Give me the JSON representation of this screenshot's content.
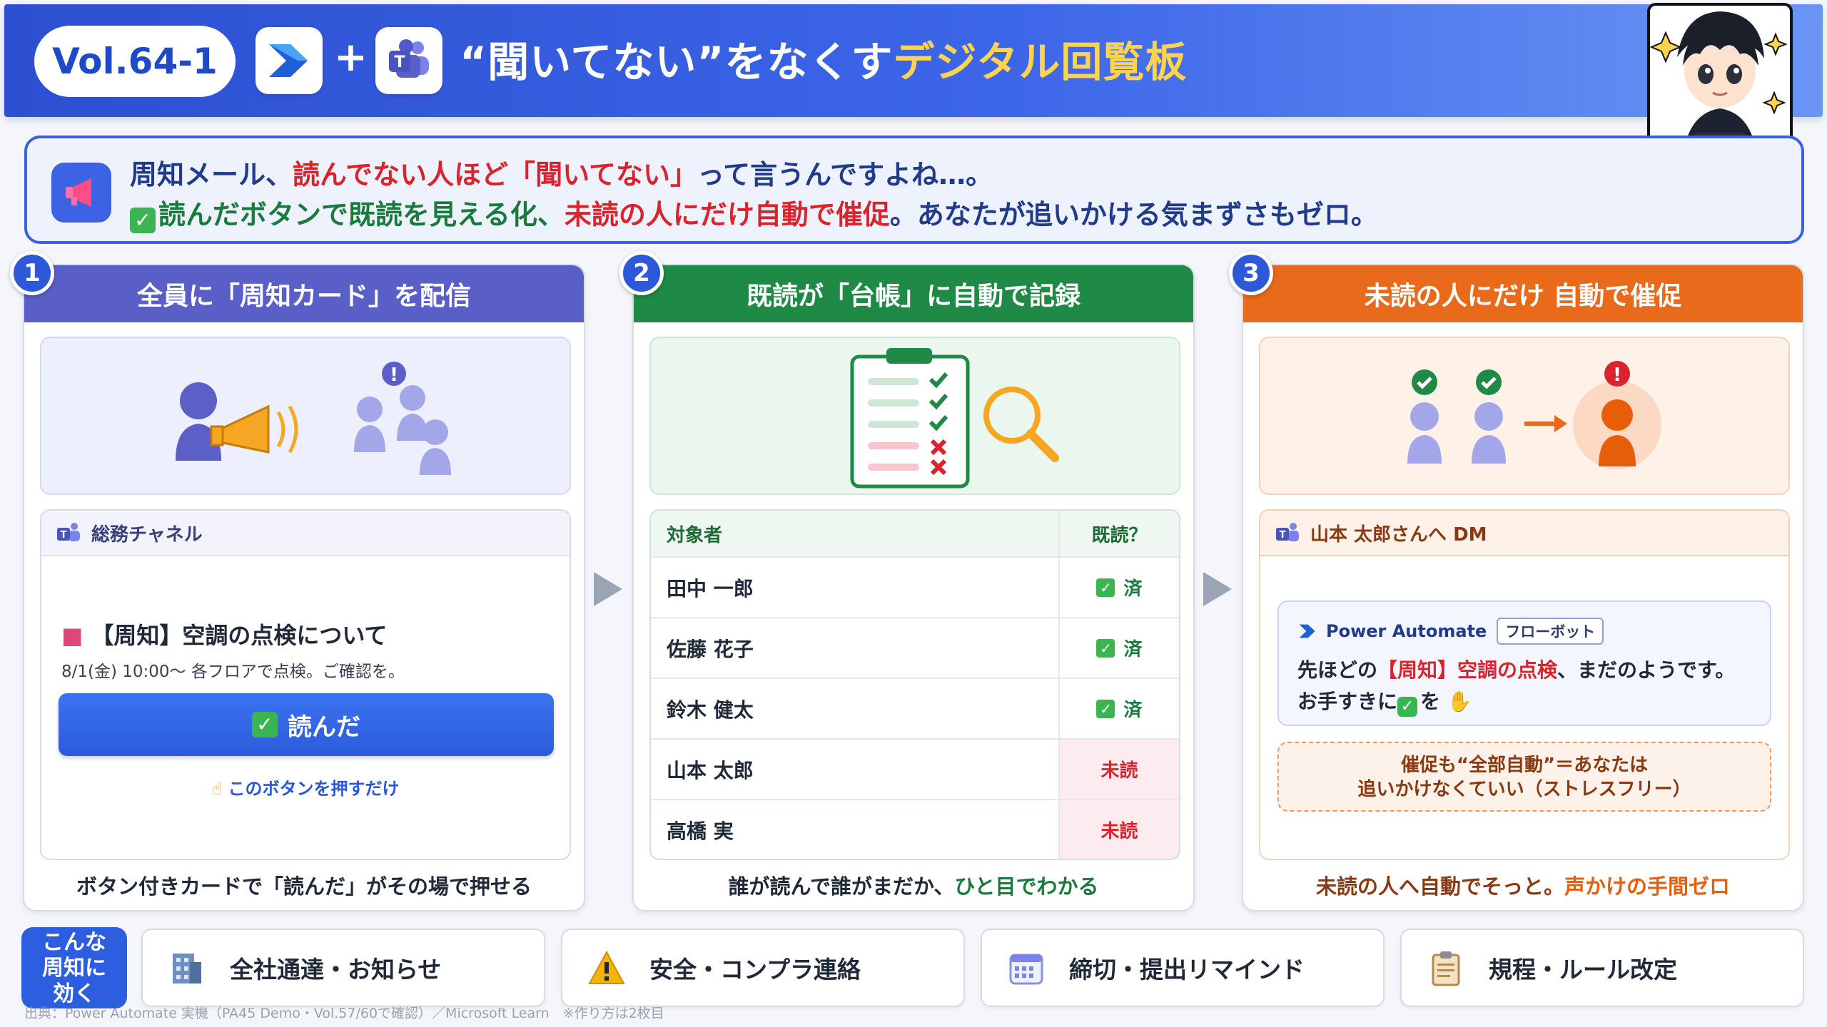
{
  "header": {
    "vol": "Vol.64-1",
    "plus": "+",
    "title_main": "“聞いてない”をなくす",
    "title_accent": "デジタル回覧板"
  },
  "intro": {
    "line1_a": "周知メール、",
    "line1_b": "読んでない人ほど「聞いてない」",
    "line1_c": "って言うんですよね…。",
    "line2_check": "✓",
    "line2_a": "読んだボタンで既読を見える化、",
    "line2_b": "未読の人にだけ自動で催促",
    "line2_c": "。あなたが追いかける気まずさもゼロ。"
  },
  "steps": [
    {
      "num": "1",
      "title": "全員に「周知カード」を配信",
      "color": "#5a5fc7",
      "channel": "総務チャネル",
      "notice_title": "【周知】空調の点検について",
      "notice_sub": "8/1(金) 10:00〜 各フロアで点検。ご確認を。",
      "button_label": "読んだ",
      "button_hint": "このボタンを押すだけ",
      "footer": "ボタン付きカードで「読んだ」がその場で押せる"
    },
    {
      "num": "2",
      "title": "既読が「台帳」に自動で記録",
      "color": "#1f8a45",
      "col_name": "対象者",
      "col_status": "既読？",
      "rows": [
        {
          "name": "田中 一郎",
          "status": "済",
          "read": true
        },
        {
          "name": "佐藤 花子",
          "status": "済",
          "read": true
        },
        {
          "name": "鈴木 健太",
          "status": "済",
          "read": true
        },
        {
          "name": "山本 太郎",
          "status": "未読",
          "read": false
        },
        {
          "name": "高橋 実",
          "status": "未読",
          "read": false
        }
      ],
      "footer_a": "誰が読んで誰がまだか、",
      "footer_b": "ひと目でわかる"
    },
    {
      "num": "3",
      "title": "未読の人にだけ 自動で催促",
      "color": "#ea6a1c",
      "dm_to": "山本 太郎さんへ DM",
      "bot_name": "Power Automate",
      "bot_tag": "フローボット",
      "msg1_a": "先ほどの",
      "msg1_b": "【周知】空調の点検",
      "msg1_c": "、まだのようです。",
      "msg2": "お手すきに",
      "msg2_check": "✓",
      "msg2_b": "を",
      "stress_line1": "催促も“全部自動”＝あなたは",
      "stress_line2": "追いかけなくていい（ストレスフリー）",
      "footer_a": "未読の人へ自動でそっと。",
      "footer_b": "声かけの手間ゼロ"
    }
  ],
  "uses": {
    "label_lines": [
      "こんな",
      "周知に",
      "効く"
    ],
    "items": [
      {
        "label": "全社通達・お知らせ",
        "icon": "office-building-icon"
      },
      {
        "label": "安全・コンプラ連絡",
        "icon": "warning-icon"
      },
      {
        "label": "締切・提出リマインド",
        "icon": "calendar-icon"
      },
      {
        "label": "規程・ルール改定",
        "icon": "clipboard-icon"
      }
    ]
  },
  "source": "出典：Power Automate 実機（PA45 Demo・Vol.57/60で確認）／Microsoft Learn　※作り方は2枚目"
}
